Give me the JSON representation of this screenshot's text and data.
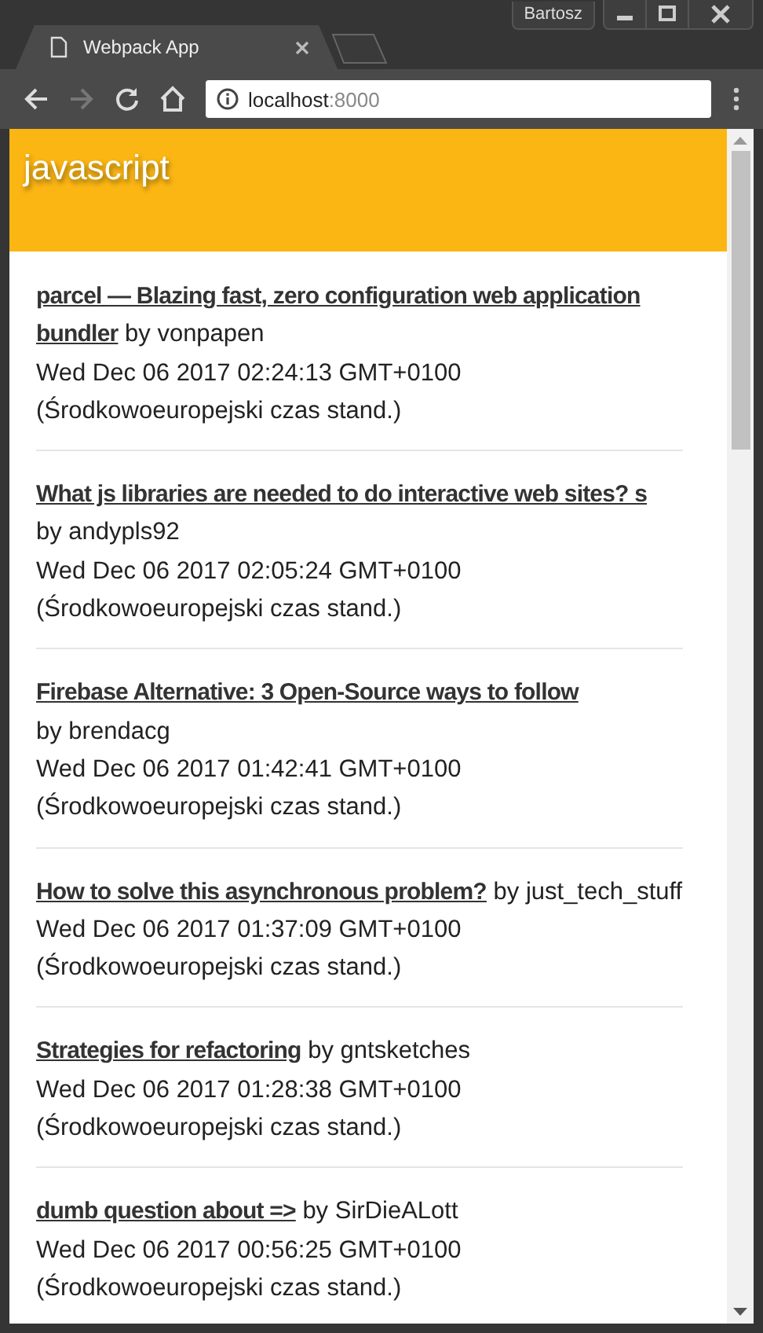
{
  "window": {
    "user": "Bartosz"
  },
  "tabs": [
    {
      "title": "Webpack App",
      "selected": true
    }
  ],
  "toolbar": {
    "host": "localhost",
    "port": ":8000"
  },
  "page": {
    "heading": "javascript",
    "posts": [
      {
        "title": "parcel — Blazing fast, zero configuration web application bundler",
        "byline": "by vonpapen",
        "date": "Wed Dec 06 2017 02:24:13 GMT+0100 (Środkowoeuropejski czas stand.)"
      },
      {
        "title": "What js libraries are needed to do interactive web sites? s",
        "byline": "by andypls92",
        "date": "Wed Dec 06 2017 02:05:24 GMT+0100 (Środkowoeuropejski czas stand.)"
      },
      {
        "title": "Firebase Alternative: 3 Open-Source ways to follow",
        "byline": "by brendacg",
        "date": "Wed Dec 06 2017 01:42:41 GMT+0100 (Środkowoeuropejski czas stand.)"
      },
      {
        "title": "How to solve this asynchronous problem?",
        "byline": "by just_tech_stuff",
        "date": "Wed Dec 06 2017 01:37:09 GMT+0100 (Środkowoeuropejski czas stand.)"
      },
      {
        "title": "Strategies for refactoring",
        "byline": "by gntsketches",
        "date": "Wed Dec 06 2017 01:28:38 GMT+0100 (Środkowoeuropejski czas stand.)"
      },
      {
        "title": "dumb question about =>",
        "byline": "by SirDieALott",
        "date": "Wed Dec 06 2017 00:56:25 GMT+0100 (Środkowoeuropejski czas stand.)"
      }
    ]
  }
}
